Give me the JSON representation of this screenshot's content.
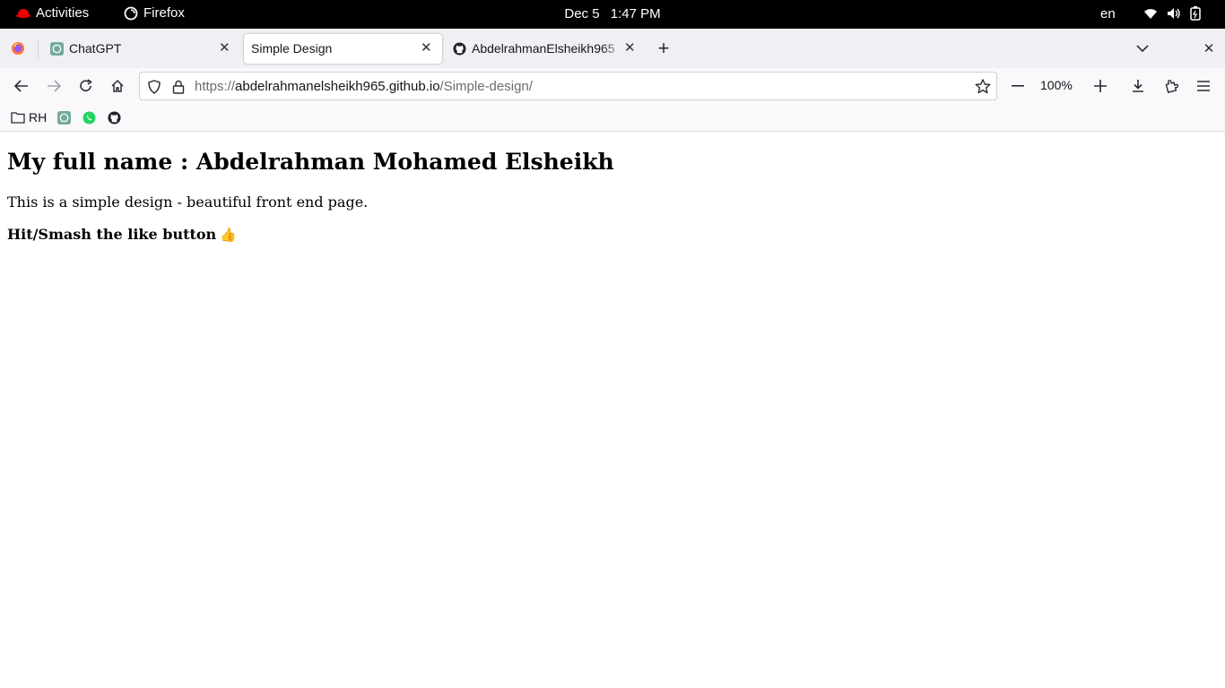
{
  "system_bar": {
    "activities_label": "Activities",
    "app_name": "Firefox",
    "date": "Dec 5",
    "time": "1:47 PM",
    "language": "en",
    "tray_icons": [
      "wifi-icon",
      "volume-icon",
      "battery-icon"
    ]
  },
  "tabs": [
    {
      "title": "ChatGPT",
      "icon": "chatgpt-icon",
      "active": false
    },
    {
      "title": "Simple Design",
      "icon": "",
      "active": true
    },
    {
      "title": "AbdelrahmanElsheikh965",
      "icon": "github-icon",
      "active": false
    }
  ],
  "navigation": {
    "url_scheme": "https://",
    "url_host": "abdelrahmanelsheikh965.github.io",
    "url_path": "/Simple-design/",
    "zoom_level": "100%"
  },
  "bookmarks": [
    {
      "label": "RH",
      "icon": "folder-icon"
    },
    {
      "label": "",
      "icon": "chatgpt-icon"
    },
    {
      "label": "",
      "icon": "whatsapp-icon"
    },
    {
      "label": "",
      "icon": "github-icon"
    }
  ],
  "page": {
    "heading": "My full name : Abdelrahman Mohamed Elsheikh",
    "intro": "This is a simple design - beautiful front end page.",
    "like_text": "Hit/Smash the like button",
    "like_emoji": "👍"
  },
  "colors": {
    "topbar_bg": "#000000",
    "tabstrip_bg": "#f0f0f4",
    "toolbar_bg": "#f9f9fb",
    "redhat_red": "#ee0000",
    "whatsapp_green": "#25d366",
    "chatgpt_teal": "#74aa9c"
  }
}
